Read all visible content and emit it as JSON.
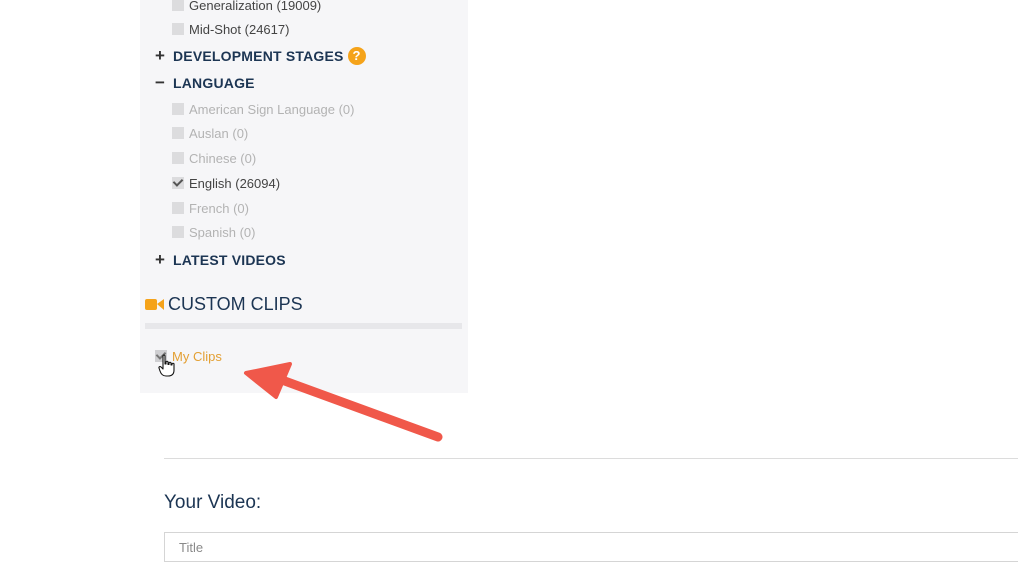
{
  "filters": {
    "shot_options": [
      {
        "label": "Generalization (19009)",
        "checked": false,
        "enabled": true
      },
      {
        "label": "Mid-Shot (24617)",
        "checked": false,
        "enabled": true
      }
    ],
    "development_stages": {
      "label": "DEVELOPMENT STAGES",
      "expanded": false,
      "help": "?"
    },
    "language": {
      "label": "LANGUAGE",
      "expanded": true,
      "options": [
        {
          "label": "American Sign Language (0)",
          "checked": false,
          "enabled": false
        },
        {
          "label": "Auslan (0)",
          "checked": false,
          "enabled": false
        },
        {
          "label": "Chinese (0)",
          "checked": false,
          "enabled": false
        },
        {
          "label": "English (26094)",
          "checked": true,
          "enabled": true
        },
        {
          "label": "French (0)",
          "checked": false,
          "enabled": false
        },
        {
          "label": "Spanish (0)",
          "checked": false,
          "enabled": false
        }
      ]
    },
    "latest_videos": {
      "label": "LATEST VIDEOS",
      "expanded": false
    }
  },
  "custom_clips": {
    "heading": "CUSTOM CLIPS",
    "icon": "video-camera-icon",
    "my_clips": {
      "label": "My Clips",
      "checked": true
    }
  },
  "your_video": {
    "heading": "Your Video:",
    "title_placeholder": "Title",
    "title_value": ""
  },
  "colors": {
    "accent": "#f5a31a",
    "heading": "#1c3553",
    "annotation_arrow": "#f0584a"
  }
}
